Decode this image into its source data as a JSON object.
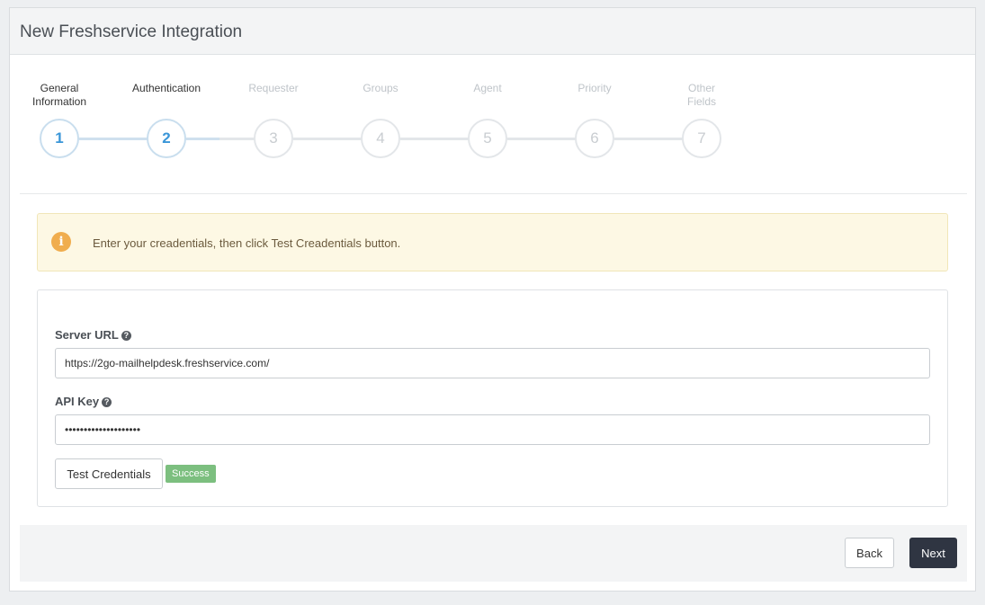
{
  "window": {
    "title": "New Freshservice Integration"
  },
  "wizard": {
    "steps": [
      {
        "number": "1",
        "label_line1": "General",
        "label_line2": "Information",
        "state": "done"
      },
      {
        "number": "2",
        "label_line1": "Authentication",
        "label_line2": "",
        "state": "active"
      },
      {
        "number": "3",
        "label_line1": "Requester",
        "label_line2": "",
        "state": "pending"
      },
      {
        "number": "4",
        "label_line1": "Groups",
        "label_line2": "",
        "state": "pending"
      },
      {
        "number": "5",
        "label_line1": "Agent",
        "label_line2": "",
        "state": "pending"
      },
      {
        "number": "6",
        "label_line1": "Priority",
        "label_line2": "",
        "state": "pending"
      },
      {
        "number": "7",
        "label_line1": "Other",
        "label_line2": "Fields",
        "state": "pending"
      }
    ]
  },
  "alert": {
    "icon": "info-icon",
    "icon_glyph": "i",
    "text": "Enter your creadentials, then click Test Creadentials button."
  },
  "form": {
    "server_url": {
      "label": "Server URL",
      "help_glyph": "?",
      "value": "https://2go-mailhelpdesk.freshservice.com/"
    },
    "api_key": {
      "label": "API Key",
      "help_glyph": "?",
      "value": "••••••••••••••••••••"
    },
    "test_button": "Test Credentials",
    "status_badge": "Success"
  },
  "footer": {
    "back_label": "Back",
    "next_label": "Next"
  },
  "colors": {
    "accent": "#3a96d8",
    "primary_button": "#2f3542",
    "success": "#7cbf7f",
    "alert_bg": "#fdf8e4",
    "alert_icon": "#f0ad4e"
  }
}
